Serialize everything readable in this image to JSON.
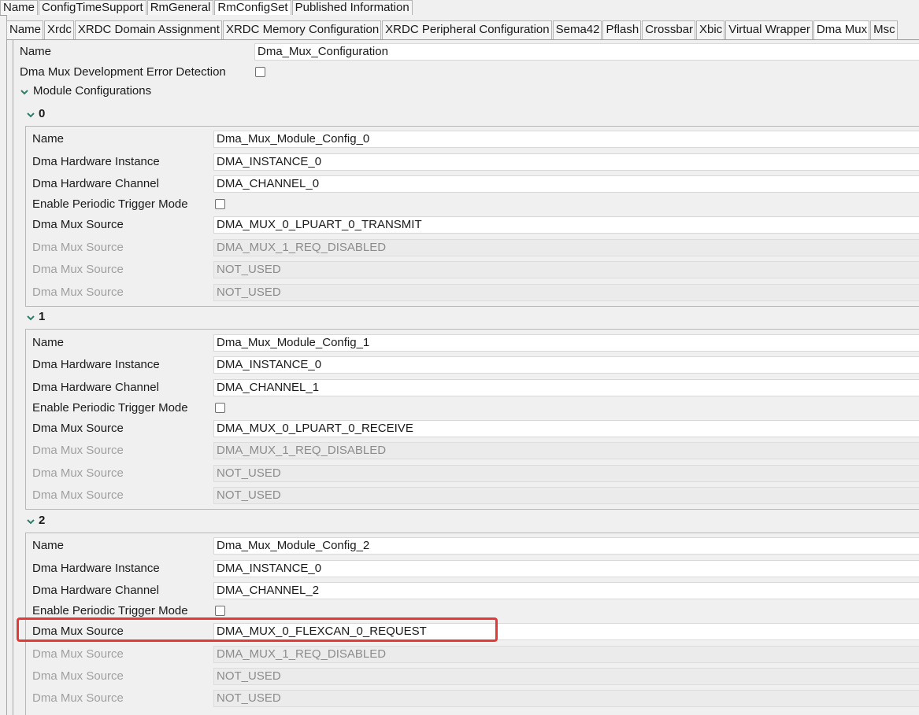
{
  "outer_tabs": [
    "Name",
    "ConfigTimeSupport",
    "RmGeneral",
    "RmConfigSet",
    "Published Information"
  ],
  "inner_tabs": [
    "Name",
    "Xrdc",
    "XRDC Domain Assignment",
    "XRDC Memory Configuration",
    "XRDC Peripheral Configuration",
    "Sema42",
    "Pflash",
    "Crossbar",
    "Xbic",
    "Virtual Wrapper",
    "Dma Mux",
    "Msc"
  ],
  "form": {
    "name_label": "Name",
    "name_value": "Dma_Mux_Configuration",
    "dev_error_label": "Dma Mux Development Error Detection",
    "module_configs_label": "Module Configurations"
  },
  "modules": [
    {
      "index": "0",
      "name_label": "Name",
      "name_value": "Dma_Mux_Module_Config_0",
      "instance_label": "Dma Hardware Instance",
      "instance_value": "DMA_INSTANCE_0",
      "channel_label": "Dma Hardware Channel",
      "channel_value": "DMA_CHANNEL_0",
      "periodic_label": "Enable Periodic Trigger Mode",
      "sources": [
        {
          "label": "Dma Mux Source",
          "value": "DMA_MUX_0_LPUART_0_TRANSMIT"
        },
        {
          "label": "Dma Mux Source",
          "value": "DMA_MUX_1_REQ_DISABLED"
        },
        {
          "label": "Dma Mux Source",
          "value": "NOT_USED"
        },
        {
          "label": "Dma Mux Source",
          "value": "NOT_USED"
        }
      ]
    },
    {
      "index": "1",
      "name_label": "Name",
      "name_value": "Dma_Mux_Module_Config_1",
      "instance_label": "Dma Hardware Instance",
      "instance_value": "DMA_INSTANCE_0",
      "channel_label": "Dma Hardware Channel",
      "channel_value": "DMA_CHANNEL_1",
      "periodic_label": "Enable Periodic Trigger Mode",
      "sources": [
        {
          "label": "Dma Mux Source",
          "value": "DMA_MUX_0_LPUART_0_RECEIVE"
        },
        {
          "label": "Dma Mux Source",
          "value": "DMA_MUX_1_REQ_DISABLED"
        },
        {
          "label": "Dma Mux Source",
          "value": "NOT_USED"
        },
        {
          "label": "Dma Mux Source",
          "value": "NOT_USED"
        }
      ]
    },
    {
      "index": "2",
      "name_label": "Name",
      "name_value": "Dma_Mux_Module_Config_2",
      "instance_label": "Dma Hardware Instance",
      "instance_value": "DMA_INSTANCE_0",
      "channel_label": "Dma Hardware Channel",
      "channel_value": "DMA_CHANNEL_2",
      "periodic_label": "Enable Periodic Trigger Mode",
      "sources": [
        {
          "label": "Dma Mux Source",
          "value": "DMA_MUX_0_FLEXCAN_0_REQUEST"
        },
        {
          "label": "Dma Mux Source",
          "value": "DMA_MUX_1_REQ_DISABLED"
        },
        {
          "label": "Dma Mux Source",
          "value": "NOT_USED"
        },
        {
          "label": "Dma Mux Source",
          "value": "NOT_USED"
        }
      ]
    }
  ],
  "colors": {
    "highlight": "#e53935",
    "accent_chevron": "#2e7d6a"
  }
}
